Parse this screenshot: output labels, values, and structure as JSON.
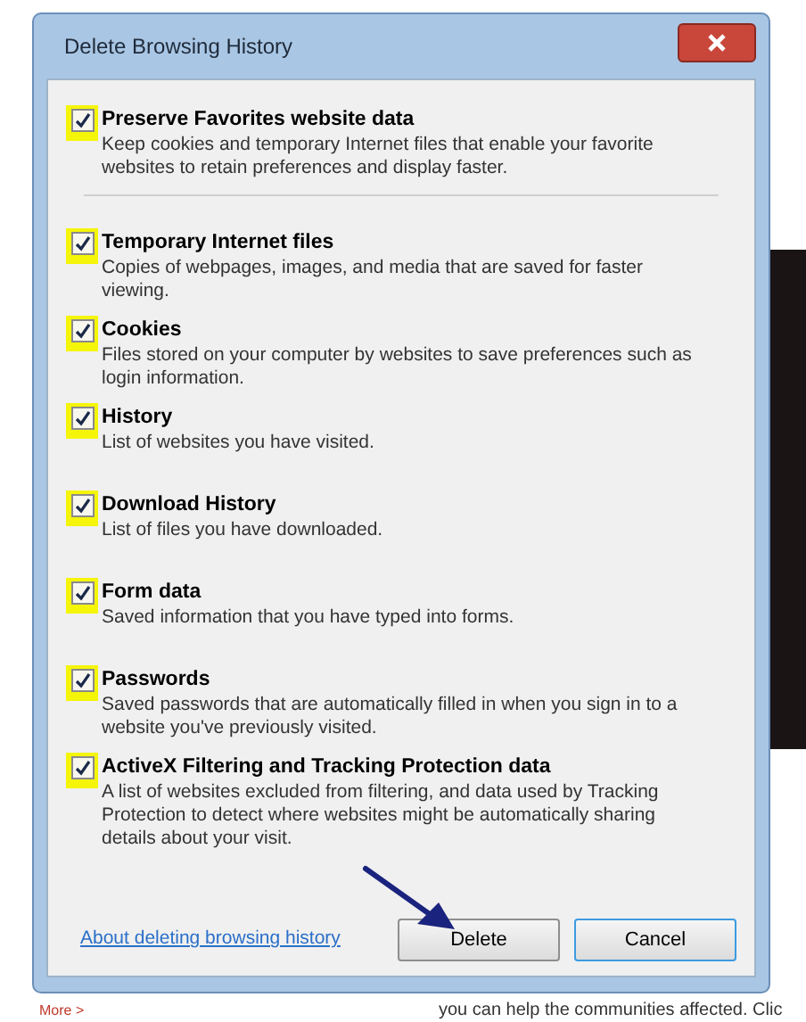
{
  "window": {
    "title": "Delete Browsing History"
  },
  "items": [
    {
      "label": "Preserve Favorites website data",
      "description": "Keep cookies and temporary Internet files that enable your favorite websites to retain preferences and display faster.",
      "checked": true
    },
    {
      "label": "Temporary Internet files",
      "description": "Copies of webpages, images, and media that are saved for faster viewing.",
      "checked": true
    },
    {
      "label": "Cookies",
      "description": "Files stored on your computer by websites to save preferences such as login information.",
      "checked": true
    },
    {
      "label": "History",
      "description": "List of websites you have visited.",
      "checked": true
    },
    {
      "label": "Download History",
      "description": "List of files you have downloaded.",
      "checked": true
    },
    {
      "label": "Form data",
      "description": "Saved information that you have typed into forms.",
      "checked": true
    },
    {
      "label": "Passwords",
      "description": "Saved passwords that are automatically filled in when you sign in to a website you've previously visited.",
      "checked": true
    },
    {
      "label": "ActiveX Filtering and Tracking Protection data",
      "description": "A list of websites excluded from filtering, and data used by Tracking Protection to detect where websites might be automatically sharing details about your visit.",
      "checked": true
    }
  ],
  "footer": {
    "link": "About deleting browsing history",
    "buttons": [
      "Delete",
      "Cancel"
    ]
  },
  "background_page": {
    "link": "More >",
    "text": "you can help the communities affected. Clic"
  }
}
